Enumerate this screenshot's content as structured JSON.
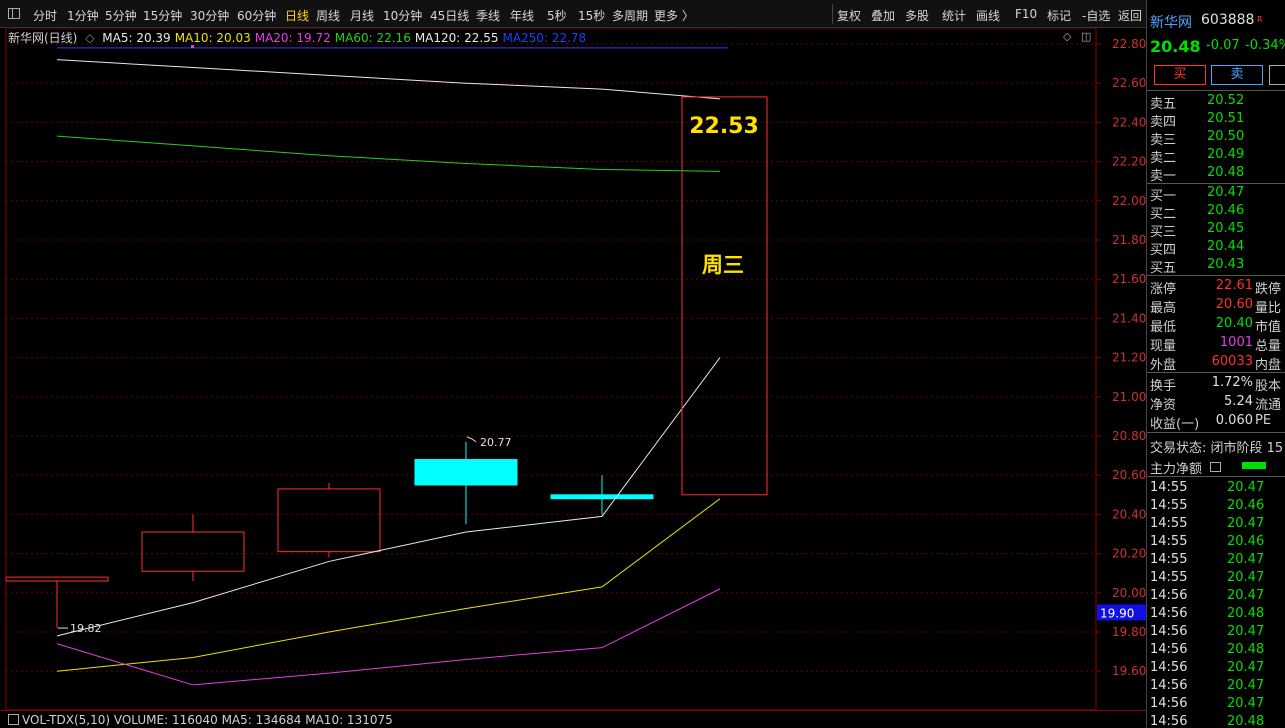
{
  "toolbar": {
    "left_items": [
      "分时",
      "1分钟",
      "5分钟",
      "15分钟",
      "30分钟",
      "60分钟",
      "日线",
      "周线",
      "月线",
      "10分钟",
      "45日线",
      "季线",
      "年线",
      "5秒",
      "15秒",
      "多周期",
      "更多 〉"
    ],
    "active_item": "日线",
    "right_items": [
      "复权",
      "叠加",
      "多股",
      "统计",
      "画线",
      "F10",
      "标记",
      "-自选",
      "返回"
    ]
  },
  "legend": {
    "stock_title": "新华网(日线)",
    "items": [
      {
        "text": "MA5: 20.39",
        "color": "#e8e8e8"
      },
      {
        "text": "MA10: 20.03",
        "color": "#e6e600"
      },
      {
        "text": "MA20: 19.72",
        "color": "#e040e0"
      },
      {
        "text": "MA60: 22.16",
        "color": "#20d020"
      },
      {
        "text": "MA120: 22.55",
        "color": "#e8e8e8"
      },
      {
        "text": "MA250: 22.78",
        "color": "#2040ff"
      }
    ],
    "icons": [
      "diamond-icon",
      "square-icon"
    ]
  },
  "chart_data": {
    "type": "candlestick",
    "y_axis": {
      "min": 19.5,
      "max": 22.9,
      "ticks": [
        22.8,
        22.6,
        22.4,
        22.2,
        22.0,
        21.8,
        21.6,
        21.4,
        21.2,
        21.0,
        20.8,
        20.6,
        20.4,
        20.2,
        20.0,
        19.8,
        19.6
      ]
    },
    "candles": [
      {
        "open": 20.08,
        "close": 20.06,
        "high": 20.08,
        "low": 19.82,
        "color": "#ff3030",
        "hollow": true
      },
      {
        "open": 20.11,
        "close": 20.31,
        "high": 20.4,
        "low": 20.06,
        "color": "#ff3030",
        "hollow": true
      },
      {
        "open": 20.21,
        "close": 20.53,
        "high": 20.56,
        "low": 20.18,
        "color": "#ff3030",
        "hollow": true
      },
      {
        "open": 20.68,
        "close": 20.55,
        "high": 20.77,
        "low": 20.35,
        "color": "#00ffff",
        "hollow": false
      },
      {
        "open": 20.5,
        "close": 20.48,
        "high": 20.6,
        "low": 20.4,
        "color": "#00ffff",
        "hollow": false
      }
    ],
    "series": [
      {
        "name": "MA5",
        "color": "#e8e8e8",
        "values": [
          19.78,
          19.95,
          20.16,
          20.31,
          20.39,
          21.2
        ]
      },
      {
        "name": "MA10",
        "color": "#e6e600",
        "values": [
          19.6,
          19.67,
          19.8,
          19.92,
          20.03,
          20.48
        ]
      },
      {
        "name": "MA20",
        "color": "#e040e0",
        "values": [
          19.74,
          19.53,
          19.59,
          19.66,
          19.72,
          20.02
        ]
      },
      {
        "name": "MA60",
        "color": "#20d020",
        "values": [
          22.33,
          22.28,
          22.23,
          22.19,
          22.16,
          22.15
        ]
      },
      {
        "name": "MA120",
        "color": "#e8e8e8",
        "values": [
          22.72,
          22.68,
          22.64,
          22.6,
          22.57,
          22.52
        ]
      },
      {
        "name": "MA250",
        "color": "#2040ff",
        "values": [
          22.78,
          22.78,
          22.78,
          22.78,
          22.78,
          22.78
        ]
      }
    ],
    "annotations": {
      "high_label": "20.77",
      "low_label": "19.82",
      "forecast_box": {
        "top_value": 22.53,
        "bottom_value": 20.5,
        "price_label": "22.53",
        "day_label": "周三"
      },
      "current_price_tag": "19.90",
      "current_price_value": 19.9
    }
  },
  "volume_legend": "VOL-TDX(5,10) VOLUME: 116040 MA5: 134684 MA10: 131075",
  "right_panel": {
    "name": "新华网",
    "code": "603888",
    "badge": "R",
    "price": "20.48",
    "change": "-0.07",
    "change_pct": "-0.34%",
    "buy_label": "买",
    "sell_label": "卖",
    "asks": [
      {
        "label": "卖五",
        "price": "20.52"
      },
      {
        "label": "卖四",
        "price": "20.51"
      },
      {
        "label": "卖三",
        "price": "20.50"
      },
      {
        "label": "卖二",
        "price": "20.49"
      },
      {
        "label": "卖一",
        "price": "20.48"
      }
    ],
    "bids": [
      {
        "label": "买一",
        "price": "20.47"
      },
      {
        "label": "买二",
        "price": "20.46"
      },
      {
        "label": "买三",
        "price": "20.45"
      },
      {
        "label": "买四",
        "price": "20.44"
      },
      {
        "label": "买五",
        "price": "20.43"
      }
    ],
    "stats1": [
      {
        "label": "涨停",
        "value": "22.61",
        "extra": "跌停",
        "color": "red"
      },
      {
        "label": "最高",
        "value": "20.60",
        "extra": "量比",
        "color": "red"
      },
      {
        "label": "最低",
        "value": "20.40",
        "extra": "市值",
        "color": "green"
      },
      {
        "label": "现量",
        "value": "1001",
        "extra": "总量",
        "color": "magenta"
      },
      {
        "label": "外盘",
        "value": "60033",
        "extra": "内盘",
        "color": "red"
      }
    ],
    "stats2": [
      {
        "label": "换手",
        "value": "1.72%",
        "extra": "股本"
      },
      {
        "label": "净资",
        "value": "5.24",
        "extra": "流通"
      },
      {
        "label": "收益(一)",
        "value": "0.060",
        "extra": "PE"
      }
    ],
    "trade_status": "交易状态: 闭市阶段 15",
    "flow_label": "主力净额",
    "ticks": [
      {
        "time": "14:55",
        "price": "20.47"
      },
      {
        "time": "14:55",
        "price": "20.46"
      },
      {
        "time": "14:55",
        "price": "20.47"
      },
      {
        "time": "14:55",
        "price": "20.46"
      },
      {
        "time": "14:55",
        "price": "20.47"
      },
      {
        "time": "14:55",
        "price": "20.47"
      },
      {
        "time": "14:56",
        "price": "20.47"
      },
      {
        "time": "14:56",
        "price": "20.48"
      },
      {
        "time": "14:56",
        "price": "20.47"
      },
      {
        "time": "14:56",
        "price": "20.48"
      },
      {
        "time": "14:56",
        "price": "20.47"
      },
      {
        "time": "14:56",
        "price": "20.47"
      },
      {
        "time": "14:56",
        "price": "20.47"
      },
      {
        "time": "14:56",
        "price": "20.48"
      }
    ]
  }
}
